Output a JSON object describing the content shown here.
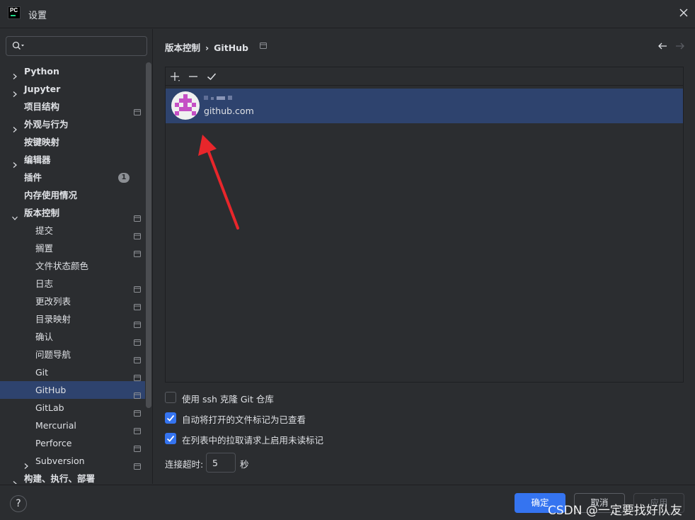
{
  "window": {
    "title": "设置"
  },
  "sidebar": {
    "search_placeholder": "",
    "items": [
      {
        "label": "Python",
        "level": 0,
        "expandable": true,
        "expanded": false,
        "bold": true
      },
      {
        "label": "Jupyter",
        "level": 0,
        "expandable": true,
        "expanded": false,
        "bold": true
      },
      {
        "label": "项目结构",
        "level": 0,
        "expandable": false,
        "bold": true,
        "project_icon": true
      },
      {
        "label": "外观与行为",
        "level": 0,
        "expandable": true,
        "expanded": false,
        "bold": true
      },
      {
        "label": "按键映射",
        "level": 0,
        "expandable": false,
        "bold": true
      },
      {
        "label": "编辑器",
        "level": 0,
        "expandable": true,
        "expanded": false,
        "bold": true
      },
      {
        "label": "插件",
        "level": 0,
        "expandable": false,
        "bold": true,
        "badge": "1"
      },
      {
        "label": "内存使用情况",
        "level": 0,
        "expandable": false,
        "bold": true
      },
      {
        "label": "版本控制",
        "level": 0,
        "expandable": true,
        "expanded": true,
        "bold": true,
        "project_icon": true
      },
      {
        "label": "提交",
        "level": 1,
        "project_icon": true
      },
      {
        "label": "搁置",
        "level": 1,
        "project_icon": true
      },
      {
        "label": "文件状态颜色",
        "level": 1
      },
      {
        "label": "日志",
        "level": 1,
        "project_icon": true
      },
      {
        "label": "更改列表",
        "level": 1,
        "project_icon": true
      },
      {
        "label": "目录映射",
        "level": 1,
        "project_icon": true
      },
      {
        "label": "确认",
        "level": 1,
        "project_icon": true
      },
      {
        "label": "问题导航",
        "level": 1,
        "project_icon": true
      },
      {
        "label": "Git",
        "level": 1,
        "project_icon": true
      },
      {
        "label": "GitHub",
        "level": 1,
        "project_icon": true,
        "selected": true
      },
      {
        "label": "GitLab",
        "level": 1,
        "project_icon": true
      },
      {
        "label": "Mercurial",
        "level": 1,
        "project_icon": true
      },
      {
        "label": "Perforce",
        "level": 1,
        "project_icon": true
      },
      {
        "label": "Subversion",
        "level": 1,
        "expandable": true,
        "expanded": false,
        "project_icon": true
      },
      {
        "label": "构建、执行、部署",
        "level": 0,
        "expandable": true,
        "expanded": false,
        "bold": true
      }
    ]
  },
  "breadcrumb": {
    "parent": "版本控制",
    "separator": "›",
    "current": "GitHub"
  },
  "accounts": {
    "toolbar": {
      "add_icon": "plus-icon",
      "remove_icon": "minus-icon",
      "default_icon": "check-icon"
    },
    "items": [
      {
        "server": "github.com",
        "selected": true
      }
    ]
  },
  "options": {
    "clone_ssh": {
      "label": "使用 ssh 克隆 Git 仓库",
      "checked": false
    },
    "mark_opened": {
      "label": "自动将打开的文件标记为已查看",
      "checked": true
    },
    "unread_markers": {
      "label": "在列表中的拉取请求上启用未读标记",
      "checked": true
    }
  },
  "timeout": {
    "label": "连接超时:",
    "value": "5",
    "unit": "秒"
  },
  "footer": {
    "help": "?",
    "ok": "确定",
    "cancel": "取消",
    "apply": "应用",
    "watermark": "CSDN @一定要找好队友"
  },
  "colors": {
    "background": "#2b2d30",
    "selection": "#2e436e",
    "accent": "#3574f0",
    "arrow": "#e8262b",
    "avatar_pattern": "#c54fc5"
  }
}
